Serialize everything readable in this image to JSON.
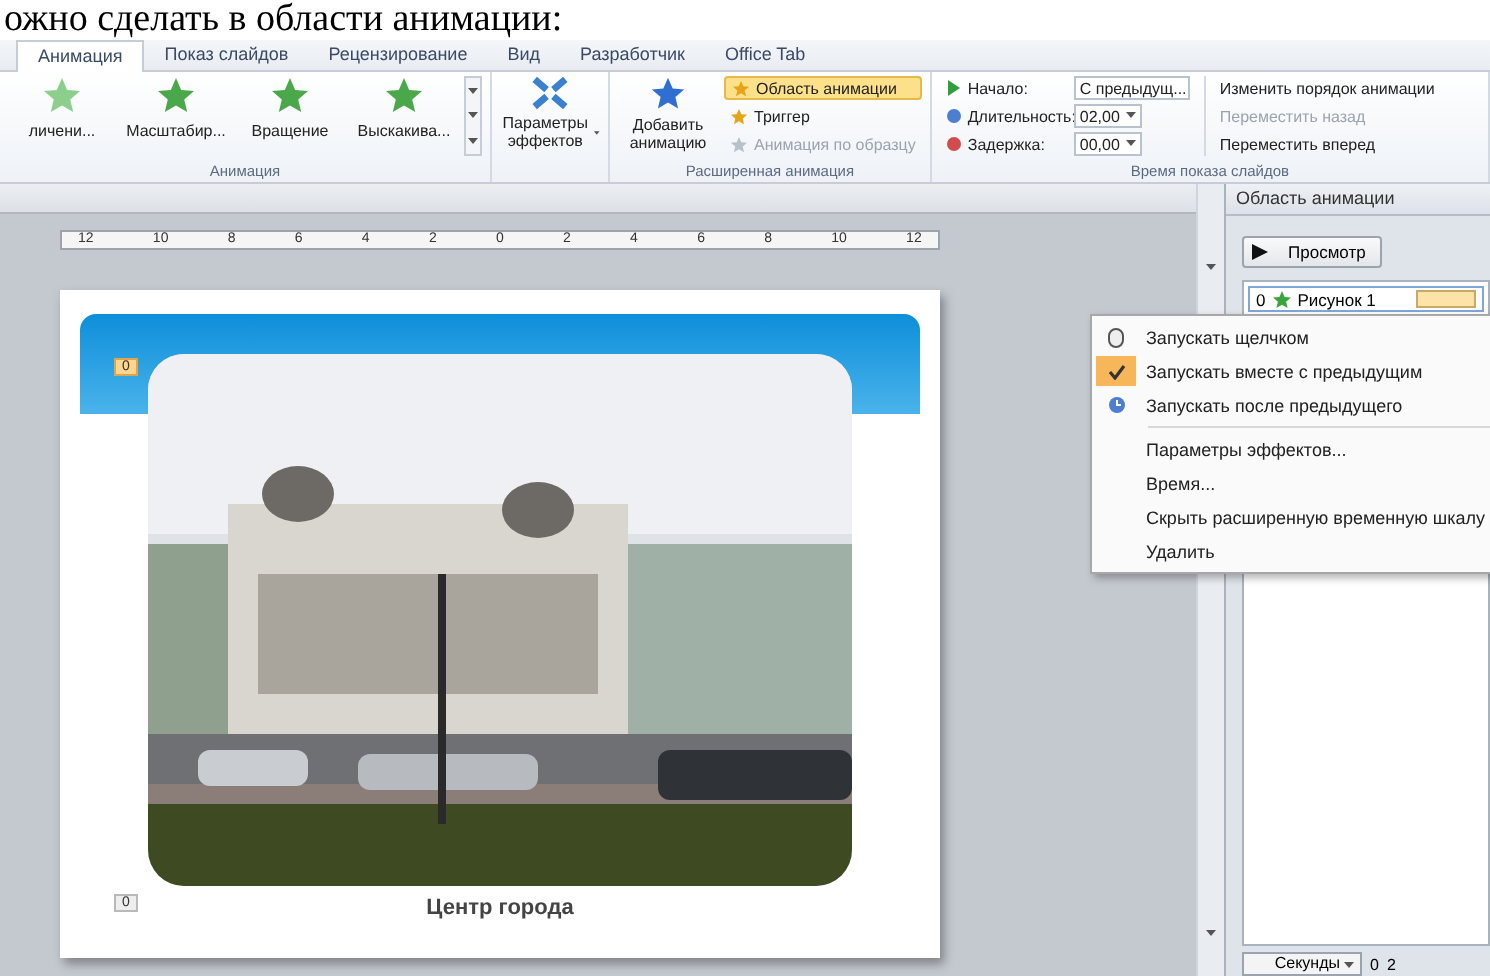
{
  "heading": "ожно сделать в области анимации:",
  "ribbon": {
    "tabs": [
      {
        "label": "Анимация",
        "selected": true
      },
      {
        "label": "Показ слайдов",
        "selected": false
      },
      {
        "label": "Рецензирование",
        "selected": false
      },
      {
        "label": "Вид",
        "selected": false
      },
      {
        "label": "Разработчик",
        "selected": false
      },
      {
        "label": "Office Tab",
        "selected": false
      }
    ],
    "gallery": [
      {
        "label": "личени..."
      },
      {
        "label": "Масштабир..."
      },
      {
        "label": "Вращение"
      },
      {
        "label": "Выскакива..."
      }
    ],
    "gallery_group": "Анимация",
    "effect_options": "Параметры эффектов",
    "add_animation": "Добавить анимацию",
    "advanced": [
      {
        "label": "Область анимации",
        "selected": true,
        "disabled": false
      },
      {
        "label": "Триггер",
        "selected": false,
        "disabled": false
      },
      {
        "label": "Анимация по образцу",
        "selected": false,
        "disabled": true
      }
    ],
    "advanced_group": "Расширенная анимация",
    "timing": [
      {
        "kind": "select",
        "label": "Начало:",
        "value": "С предыдущ..."
      },
      {
        "kind": "spin",
        "label": "Длительность:",
        "value": "02,00"
      },
      {
        "kind": "spin",
        "label": "Задержка:",
        "value": "00,00"
      }
    ],
    "reorder": {
      "title": "Изменить порядок анимации",
      "items": [
        {
          "label": "Переместить назад",
          "disabled": true
        },
        {
          "label": "Переместить вперед",
          "disabled": false
        }
      ]
    },
    "timing_group": "Время показа слайдов"
  },
  "ruler": [
    "12",
    "10",
    "8",
    "6",
    "4",
    "2",
    "0",
    "2",
    "4",
    "6",
    "8",
    "10",
    "12"
  ],
  "slide": {
    "badges": [
      {
        "label": "0",
        "selected": true
      },
      {
        "label": "0",
        "selected": false
      }
    ],
    "caption": "Центр города"
  },
  "animation_pane": {
    "title": "Область анимации",
    "play_button": "Просмотр",
    "items": [
      {
        "index": "0",
        "label": "Рисунок 1",
        "selected": true
      }
    ],
    "units": "Секунды",
    "ticks": [
      "0",
      "2"
    ]
  },
  "context_menu": [
    {
      "kind": "option",
      "label": "Запускать щелчком",
      "checked": false
    },
    {
      "kind": "option",
      "label": "Запускать вместе с предыдущим",
      "checked": true
    },
    {
      "kind": "option",
      "label": "Запускать после предыдущего",
      "checked": false
    },
    {
      "kind": "command",
      "label": "Параметры эффектов..."
    },
    {
      "kind": "command",
      "label": "Время..."
    },
    {
      "kind": "command",
      "label": "Скрыть расширенную временную шкалу"
    },
    {
      "kind": "command",
      "label": "Удалить"
    }
  ]
}
